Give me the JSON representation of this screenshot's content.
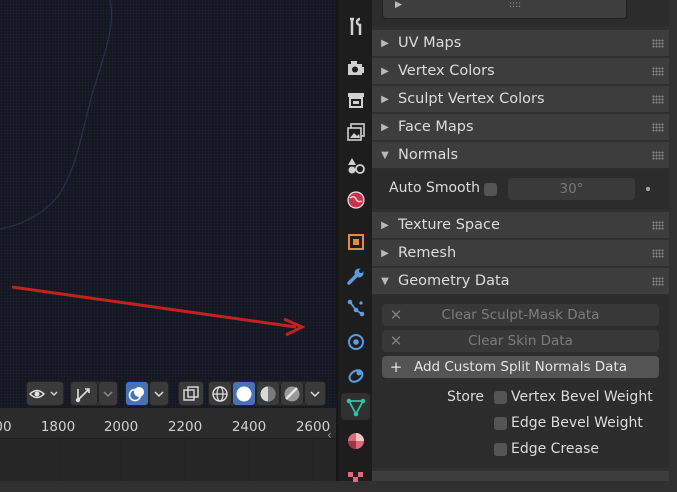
{
  "timeline": {
    "ticks": [
      "00",
      "1800",
      "2000",
      "2200",
      "2400",
      "2600"
    ]
  },
  "viewport": {
    "toolbar": [
      {
        "icon": "eye-icon"
      },
      {
        "icon": "gizmo-icon"
      },
      {
        "icon": "overlay-icon"
      },
      {
        "icon": "xray-icon"
      },
      {
        "icon": "wireframe-shading-icon"
      },
      {
        "icon": "solid-shading-icon"
      },
      {
        "icon": "material-shading-icon"
      },
      {
        "icon": "rendered-shading-icon"
      }
    ]
  },
  "properties": {
    "tabs": [
      "tool",
      "render",
      "output",
      "view-layer",
      "scene",
      "world",
      "object",
      "modifiers",
      "particles",
      "physics",
      "constraints",
      "data",
      "material",
      "texture"
    ],
    "active_tab": "data",
    "panels": [
      {
        "label": "UV Maps",
        "expanded": false
      },
      {
        "label": "Vertex Colors",
        "expanded": false
      },
      {
        "label": "Sculpt Vertex Colors",
        "expanded": false
      },
      {
        "label": "Face Maps",
        "expanded": false
      },
      {
        "label": "Normals",
        "expanded": true
      },
      {
        "label": "Texture Space",
        "expanded": false
      },
      {
        "label": "Remesh",
        "expanded": false
      },
      {
        "label": "Geometry Data",
        "expanded": true
      }
    ],
    "normals": {
      "auto_smooth_label": "Auto Smooth",
      "auto_smooth_checked": false,
      "angle": "30°"
    },
    "geometry_data": {
      "buttons": [
        {
          "label": "Clear Sculpt-Mask Data",
          "symbol": "✕",
          "enabled": false
        },
        {
          "label": "Clear Skin Data",
          "symbol": "✕",
          "enabled": false
        },
        {
          "label": "Add Custom Split Normals Data",
          "symbol": "+",
          "enabled": true
        }
      ],
      "store_label": "Store",
      "options": [
        {
          "label": "Vertex Bevel Weight",
          "checked": false
        },
        {
          "label": "Edge Bevel Weight",
          "checked": false
        },
        {
          "label": "Edge Crease",
          "checked": false
        }
      ]
    },
    "top_field": {
      "arrow": "▶",
      "grip": "::::"
    }
  },
  "colors": {
    "accent": "#4772b3",
    "annotation_arrow": "#c0231f",
    "active_tab_icon": "#2fc3a6"
  }
}
